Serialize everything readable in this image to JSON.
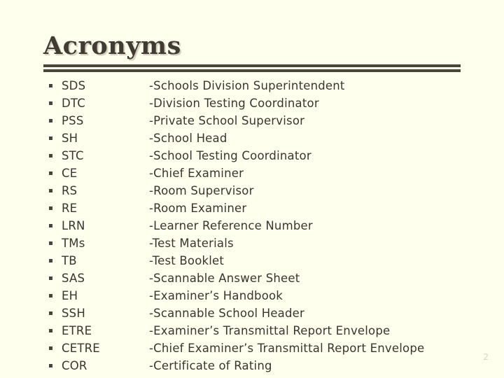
{
  "slide": {
    "title": "Acronyms",
    "page_number": "2",
    "background_color": "#FFFFEE",
    "title_color": "#413C33",
    "text_color": "#3A3530",
    "rule_color": "#4A453B",
    "page_number_color": "#DCD6BE",
    "bullet_icon": "square-bullet"
  },
  "acronyms": [
    {
      "term": "SDS",
      "definition": "-Schools Division Superintendent"
    },
    {
      "term": "DTC",
      "definition": "-Division Testing Coordinator"
    },
    {
      "term": "PSS",
      "definition": "-Private School Supervisor"
    },
    {
      "term": "SH",
      "definition": "-School Head"
    },
    {
      "term": "STC",
      "definition": "-School Testing Coordinator"
    },
    {
      "term": "CE",
      "definition": "-Chief Examiner"
    },
    {
      "term": "RS",
      "definition": "-Room Supervisor"
    },
    {
      "term": "RE",
      "definition": "-Room Examiner"
    },
    {
      "term": "LRN",
      "definition": "-Learner Reference Number"
    },
    {
      "term": "TMs",
      "definition": "-Test Materials"
    },
    {
      "term": "TB",
      "definition": "-Test Booklet"
    },
    {
      "term": "SAS",
      "definition": "-Scannable Answer Sheet"
    },
    {
      "term": "EH",
      "definition": "-Examiner’s Handbook"
    },
    {
      "term": "SSH",
      "definition": "-Scannable School Header"
    },
    {
      "term": "ETRE",
      "definition": "-Examiner’s Transmittal Report Envelope"
    },
    {
      "term": "CETRE",
      "definition": "-Chief Examiner’s Transmittal Report Envelope"
    },
    {
      "term": "COR",
      "definition": "-Certificate of Rating"
    }
  ]
}
